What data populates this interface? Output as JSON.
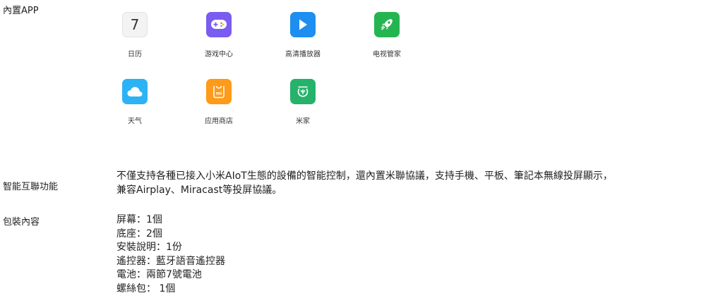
{
  "builtin_apps": {
    "label": "內置APP",
    "apps": [
      {
        "name": "日历",
        "icon": "calendar-icon",
        "icon_text": "7",
        "color": "#f3f3f3"
      },
      {
        "name": "游戏中心",
        "icon": "gamepad-icon",
        "color": "#7b5cf0"
      },
      {
        "name": "高清播放器",
        "icon": "play-icon",
        "color": "#1e8ff0"
      },
      {
        "name": "电视管家",
        "icon": "rocket-icon",
        "color": "#25b550"
      },
      {
        "name": "天气",
        "icon": "cloud-icon",
        "color": "#2bb3f5"
      },
      {
        "name": "应用商店",
        "icon": "shopping-bag-icon",
        "icon_text": "mi",
        "color": "#ff9a1a"
      },
      {
        "name": "米家",
        "icon": "mijia-icon",
        "color": "#26b26b"
      }
    ]
  },
  "smart_connect": {
    "label": "智能互聯功能",
    "lines": [
      "不僅支持各種已接入小米AIoT生態的設備的智能控制，還內置米聯協議，支持手機、平板、筆記本無線投屏顯示，",
      "兼容Airplay、Miracast等投屏協議。"
    ]
  },
  "package_contents": {
    "label": "包裝內容",
    "items": [
      "屏幕：1個",
      "底座：2個",
      "安裝說明：1份",
      "遙控器：藍牙語音遙控器",
      "電池：兩節7號電池",
      "螺絲包： 1個"
    ]
  }
}
